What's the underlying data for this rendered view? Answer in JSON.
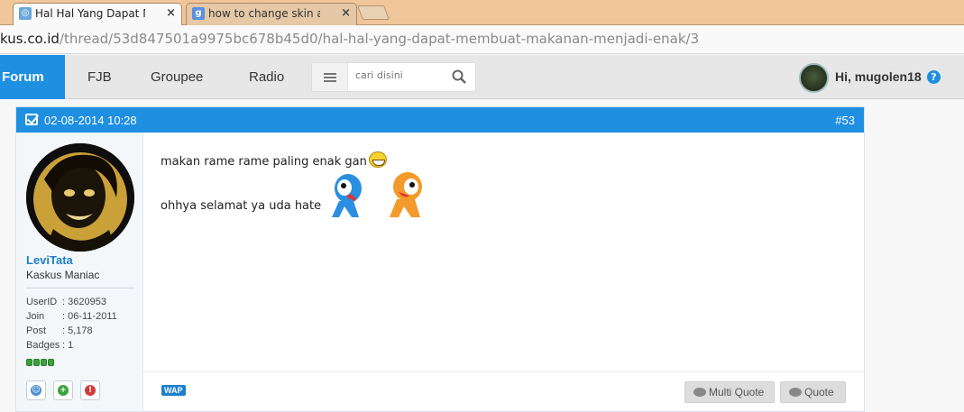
{
  "browser": {
    "tabs": [
      {
        "label": "Hal Hal Yang Dapat Memb",
        "favicon": "kaskus-icon",
        "active": true
      },
      {
        "label": "how to change skin attack",
        "favicon": "google-icon",
        "active": false
      }
    ],
    "url_host": "kus.co.id",
    "url_path": "/thread/53d847501a9975bc678b45d0/hal-hal-yang-dapat-membuat-makanan-menjadi-enak/3"
  },
  "navbar": {
    "items": [
      "Forum",
      "FJB",
      "Groupee",
      "Radio"
    ],
    "search_placeholder": "cari disini",
    "greeting": "Hi, mugolen18",
    "help": "?"
  },
  "post": {
    "date": "02-08-2014 10:28",
    "number": "#53",
    "user": {
      "name": "LeviTata",
      "rank": "Kaskus Maniac",
      "stats": [
        {
          "label": "UserID",
          "value": ": 3620953"
        },
        {
          "label": "Join",
          "value": ": 06-11-2011"
        },
        {
          "label": "Post",
          "value": ": 5,178"
        },
        {
          "label": "Badges",
          "value": ": 1"
        }
      ]
    },
    "lines": [
      "makan rame rame paling enak gan",
      "ohhya selamat ya uda hate"
    ],
    "footer": {
      "wap": "WAP",
      "multi_quote": "Multi Quote",
      "quote": "Quote"
    }
  },
  "colors": {
    "accent": "#1e8fe1",
    "tabstrip": "#f0c69a"
  }
}
